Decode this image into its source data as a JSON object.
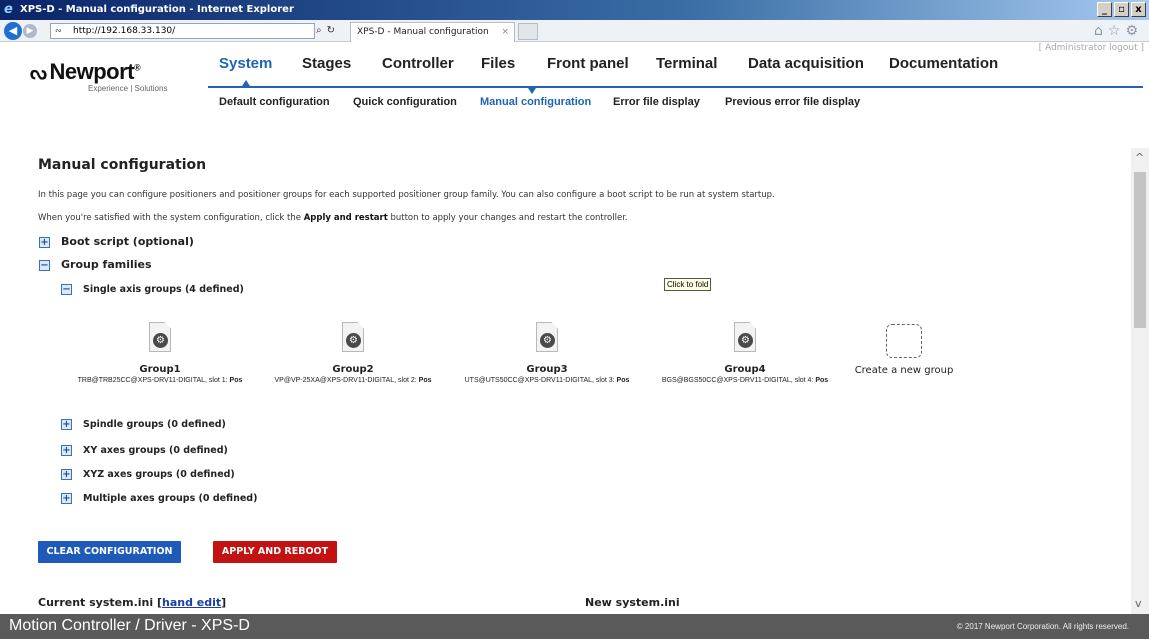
{
  "browser": {
    "window_title": "XPS-D - Manual configuration - Internet Explorer",
    "url": "http://192.168.33.130/",
    "tab_title": "XPS-D - Manual configuration",
    "window_buttons": [
      "_",
      "▫",
      "x"
    ]
  },
  "header": {
    "admin_link": "[ Administrator logout ]",
    "logo": "Newport",
    "logo_trademark": "®",
    "tagline": "Experience | Solutions",
    "nav": [
      "System",
      "Stages",
      "Controller",
      "Files",
      "Front panel",
      "Terminal",
      "Data acquisition",
      "Documentation"
    ],
    "active_nav": "System",
    "subnav": [
      "Default configuration",
      "Quick configuration",
      "Manual configuration",
      "Error file display",
      "Previous error file display"
    ],
    "active_subnav": "Manual configuration"
  },
  "content": {
    "title": "Manual configuration",
    "intro": "In this page you can configure positioners and positioner groups for each supported positioner group family. You can also configure a boot script to be run at system startup.",
    "instr_before": "When you're satisfied with the system configuration, click the ",
    "instr_bold": "Apply and restart",
    "instr_after": " button to apply your changes and restart the controller.",
    "boot_script": "Boot script (optional)",
    "group_families": "Group families",
    "single_axis": "Single axis groups (4 defined)",
    "tooltip": "Click to fold",
    "groups": [
      {
        "name": "Group1",
        "desc": "TRB@TRB25CC@XPS-DRV11-DIGITAL, slot 1: ",
        "pos": "Pos"
      },
      {
        "name": "Group2",
        "desc": "VP@VP-25XA@XPS-DRV11-DIGITAL, slot 2: ",
        "pos": "Pos"
      },
      {
        "name": "Group3",
        "desc": "UTS@UTS50CC@XPS-DRV11-DIGITAL, slot 3: ",
        "pos": "Pos"
      },
      {
        "name": "Group4",
        "desc": "BGS@BGS50CC@XPS-DRV11-DIGITAL, slot 4: ",
        "pos": "Pos"
      }
    ],
    "create_group": "Create a new group",
    "spindle": "Spindle groups (0 defined)",
    "xy": "XY axes groups (0 defined)",
    "xyz": "XYZ axes groups (0 defined)",
    "multiple": "Multiple axes groups (0 defined)",
    "clear_btn": "CLEAR CONFIGURATION",
    "apply_btn": "APPLY AND REBOOT",
    "current_ini": "Current system.ini",
    "hand_edit": "hand edit",
    "new_ini": "New system.ini"
  },
  "footer": {
    "left": "Motion Controller / Driver - XPS-D",
    "right": "© 2017 Newport Corporation. All rights reserved."
  },
  "colors": {
    "accent": "#1f64b5",
    "clear_button": "#1e5bb8",
    "apply_button": "#c31212",
    "footer": "#5a5a5a"
  }
}
